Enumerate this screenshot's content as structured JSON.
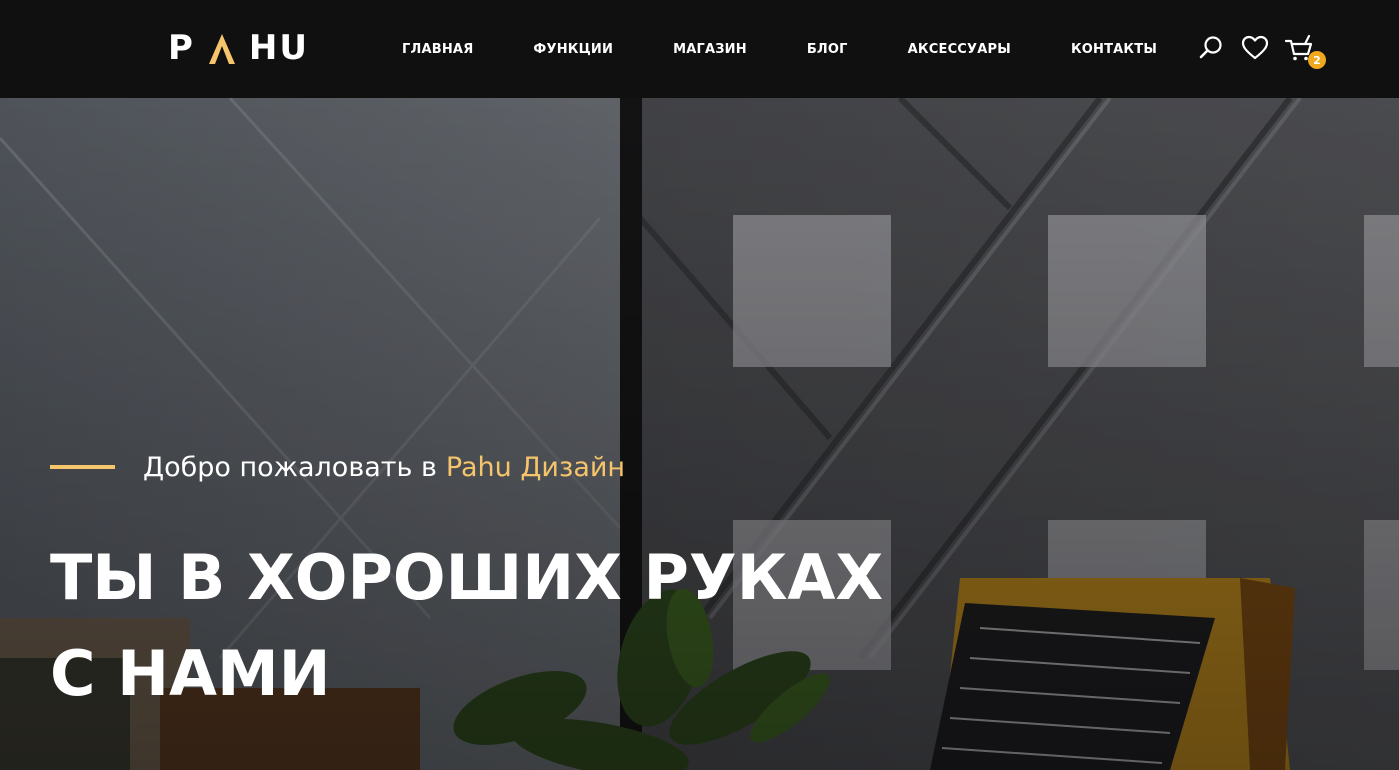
{
  "brand": {
    "logo_left": "P",
    "logo_right": "HU",
    "accent_color": "#f6c46a"
  },
  "nav": {
    "items": [
      {
        "label": "ГЛАВНАЯ"
      },
      {
        "label": "ФУНКЦИИ"
      },
      {
        "label": "МАГАЗИН"
      },
      {
        "label": "БЛОГ"
      },
      {
        "label": "АКСЕССУАРЫ"
      },
      {
        "label": "КОНТАКТЫ"
      }
    ]
  },
  "header_icons": {
    "search": "search-icon",
    "wishlist": "heart-icon",
    "cart": "cart-icon",
    "cart_count": "2",
    "badge_color": "#f0a81e"
  },
  "hero": {
    "welcome_text": "Добро пожаловать в",
    "welcome_accent": "Pahu Дизайн",
    "headline_line1": "ТЫ В ХОРОШИХ РУКАХ",
    "headline_line2": "С НАМИ"
  }
}
